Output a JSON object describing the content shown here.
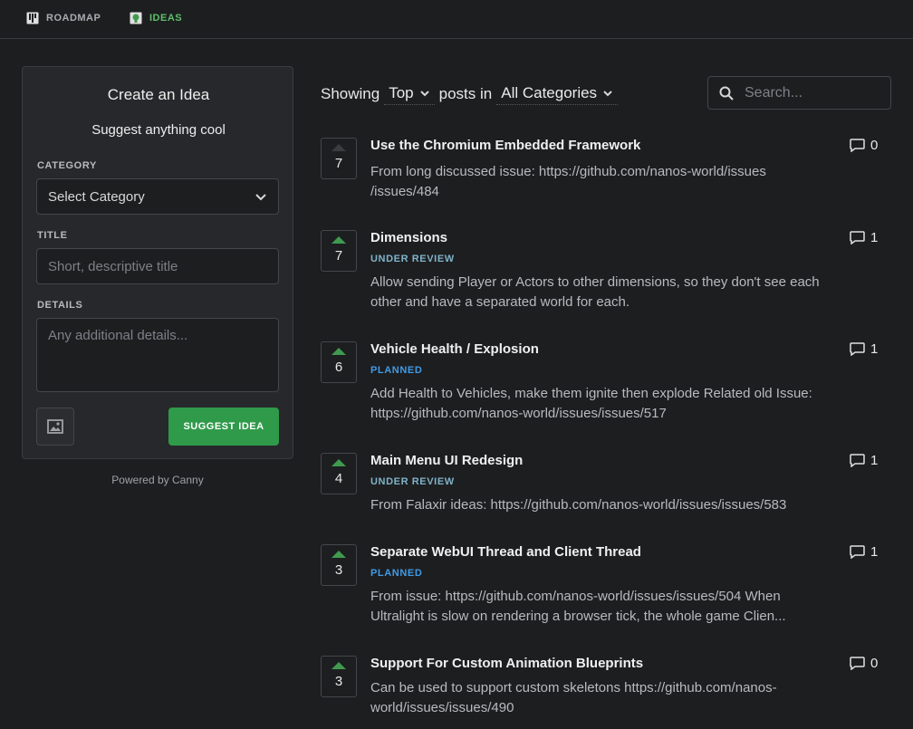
{
  "nav": {
    "roadmap_label": "ROADMAP",
    "ideas_label": "IDEAS",
    "active_color": "#5fbf6a"
  },
  "create": {
    "title": "Create an Idea",
    "subtitle": "Suggest anything cool",
    "category_label": "CATEGORY",
    "category_value": "Select Category",
    "title_label": "TITLE",
    "title_placeholder": "Short, descriptive title",
    "details_label": "DETAILS",
    "details_placeholder": "Any additional details...",
    "submit_label": "SUGGEST IDEA",
    "submit_color": "#2f9a4a"
  },
  "powered_by": "Powered by Canny",
  "filters": {
    "showing": "Showing",
    "sort": "Top",
    "posts_in": "posts in",
    "category": "All Categories"
  },
  "search": {
    "placeholder": "Search..."
  },
  "status_colors": {
    "UNDER REVIEW": "#7fb3c9",
    "PLANNED": "#3f9be6"
  },
  "posts": [
    {
      "votes": "7",
      "voted": false,
      "title": "Use the Chromium Embedded Framework",
      "status": "",
      "body": "From long discussed issue: https://github.com/nanos-world/issues /issues/484",
      "comments": "0"
    },
    {
      "votes": "7",
      "voted": true,
      "title": "Dimensions",
      "status": "UNDER REVIEW",
      "body": "Allow sending Player or Actors to other dimensions, so they don't see each other and have a separated world for each.",
      "comments": "1"
    },
    {
      "votes": "6",
      "voted": true,
      "title": "Vehicle Health / Explosion",
      "status": "PLANNED",
      "body": "Add Health to Vehicles, make them ignite then explode Related old Issue: https://github.com/nanos-world/issues/issues/517",
      "comments": "1"
    },
    {
      "votes": "4",
      "voted": true,
      "title": "Main Menu UI Redesign",
      "status": "UNDER REVIEW",
      "body": "From Falaxir ideas: https://github.com/nanos-world/issues/issues/583",
      "comments": "1"
    },
    {
      "votes": "3",
      "voted": true,
      "title": "Separate WebUI Thread and Client Thread",
      "status": "PLANNED",
      "body": "From issue: https://github.com/nanos-world/issues/issues/504 When Ultralight is slow on rendering a browser tick, the whole game Clien...",
      "comments": "1"
    },
    {
      "votes": "3",
      "voted": true,
      "title": "Support For Custom Animation Blueprints",
      "status": "",
      "body": "Can be used to support custom skeletons https://github.com/nanos-world/issues/issues/490",
      "comments": "0"
    }
  ]
}
